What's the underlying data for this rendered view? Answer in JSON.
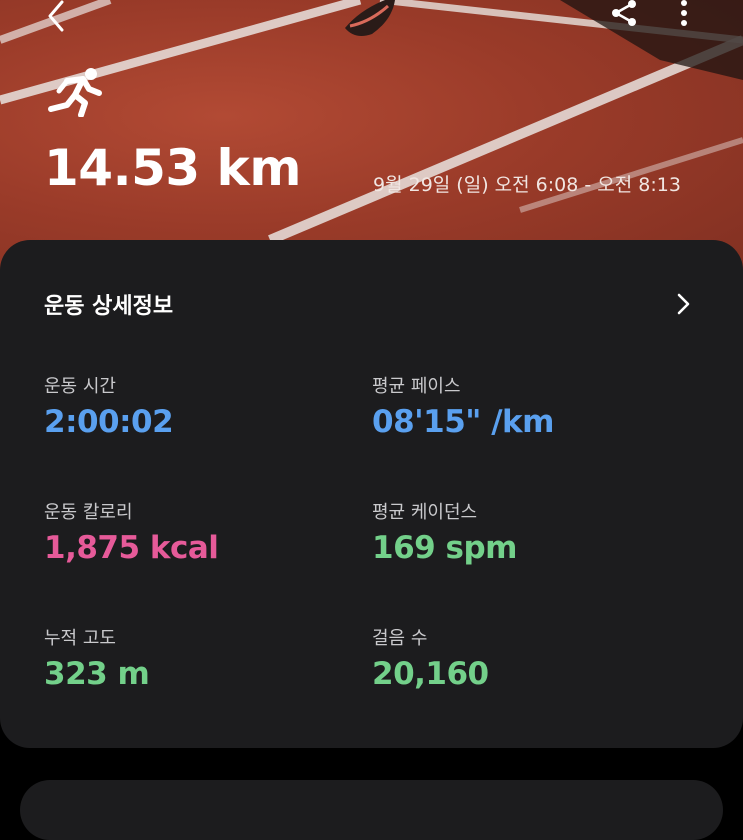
{
  "header": {
    "distance": "14.53 km",
    "datetime": "9월 29일 (일) 오전 6:08 - 오전 8:13",
    "icons": {
      "back": "chevron-left-icon",
      "share": "share-icon",
      "more": "more-vertical-icon",
      "activity": "running-icon"
    }
  },
  "details": {
    "title": "운동 상세정보",
    "stats": [
      {
        "label": "운동 시간",
        "value": "2:00:02",
        "color": "#5aa0ef"
      },
      {
        "label": "평균 페이스",
        "value": "08'15\" /km",
        "color": "#5aa0ef"
      },
      {
        "label": "운동 칼로리",
        "value": "1,875 kcal",
        "color": "#e65a99"
      },
      {
        "label": "평균 케이던스",
        "value": "169 spm",
        "color": "#73d08a"
      },
      {
        "label": "누적 고도",
        "value": "323 m",
        "color": "#73d08a"
      },
      {
        "label": "걸음 수",
        "value": "20,160",
        "color": "#73d08a"
      }
    ]
  },
  "colors": {
    "track": "#9a3b29",
    "card_bg": "#1c1c1e",
    "accent_blue": "#5aa0ef",
    "accent_pink": "#e65a99",
    "accent_green": "#73d08a"
  }
}
